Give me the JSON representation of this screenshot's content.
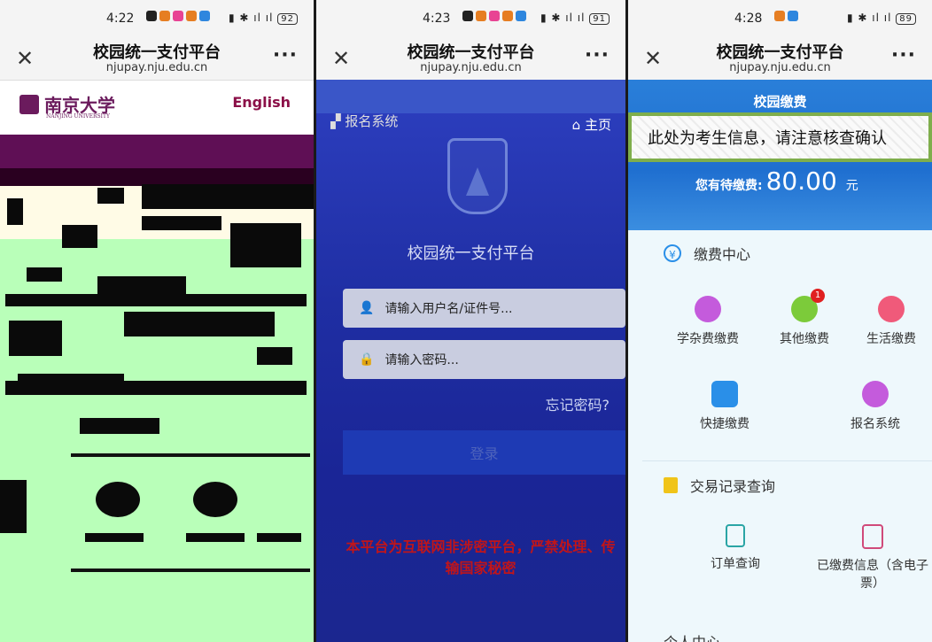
{
  "panel1": {
    "status": {
      "time": "4:22",
      "battery": "92"
    },
    "title": "校园统一支付平台",
    "url": "njupay.nju.edu.cn",
    "logo_cn": "南京大学",
    "logo_en": "NANJING UNIVERSITY",
    "english_link": "English"
  },
  "panel2": {
    "status": {
      "time": "4:23",
      "battery": "91"
    },
    "title": "校园统一支付平台",
    "url": "njupay.nju.edu.cn",
    "nav_left": "报名系统",
    "nav_right": "主页",
    "platform_title": "校园统一支付平台",
    "username_placeholder": "请输入用户名/证件号...",
    "password_placeholder": "请输入密码...",
    "forgot": "忘记密码?",
    "login": "登录",
    "warning": "本平台为互联网非涉密平台，严禁处理、传输国家秘密"
  },
  "panel3": {
    "status": {
      "time": "4:28",
      "battery": "89"
    },
    "title": "校园统一支付平台",
    "url": "njupay.nju.edu.cn",
    "header": "校园缴费",
    "notice": "此处为考生信息，请注意核查确认",
    "pending_label": "您有待缴费:",
    "pending_amount": "80.00",
    "pending_unit": "元",
    "payment_center": "缴费中心",
    "items": [
      {
        "label": "学杂费缴费",
        "color": "#c45bdc"
      },
      {
        "label": "其他缴费",
        "color": "#7ccb3a",
        "badge": "1"
      },
      {
        "label": "生活缴费",
        "color": "#f05a7a"
      },
      {
        "label": "快捷缴费",
        "color": "#2a8fe8"
      },
      {
        "label": "报名系统",
        "color": "#c45bdc"
      }
    ],
    "records": "交易记录查询",
    "record_items": [
      {
        "label": "订单查询"
      },
      {
        "label": "已缴费信息（含电子票）"
      }
    ],
    "personal": "个人中心"
  }
}
